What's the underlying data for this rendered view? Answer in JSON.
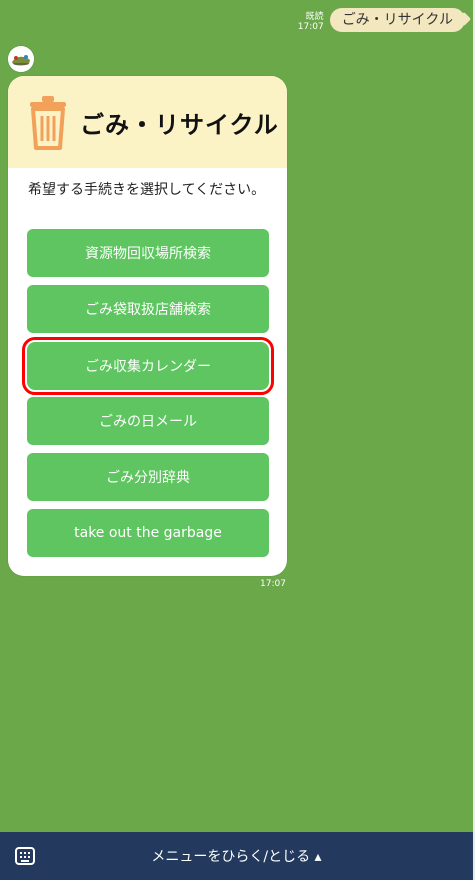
{
  "chat": {
    "sent_message": "ごみ・リサイクル",
    "read_label": "既読",
    "sent_time": "17:07"
  },
  "card": {
    "title": "ごみ・リサイクル",
    "prompt": "希望する手続きを選択してください。",
    "buttons": [
      {
        "label": "資源物回収場所検索"
      },
      {
        "label": "ごみ袋取扱店舗検索"
      },
      {
        "label": "ごみ収集カレンダー"
      },
      {
        "label": "ごみの日メール"
      },
      {
        "label": "ごみ分別辞典"
      },
      {
        "label": "take out the garbage"
      }
    ],
    "time": "17:07"
  },
  "bottom_bar": {
    "menu_text": "メニューをひらく/とじる ▴",
    "keyboard_icon": "keyboard-icon"
  },
  "colors": {
    "chat_background": "#6aa84a",
    "button_green": "#5ec560",
    "header_yellow": "#fbf2c5",
    "sent_bubble": "#f3e7bf",
    "bottom_bar": "#233a5e",
    "highlight_red": "#ff0000"
  }
}
